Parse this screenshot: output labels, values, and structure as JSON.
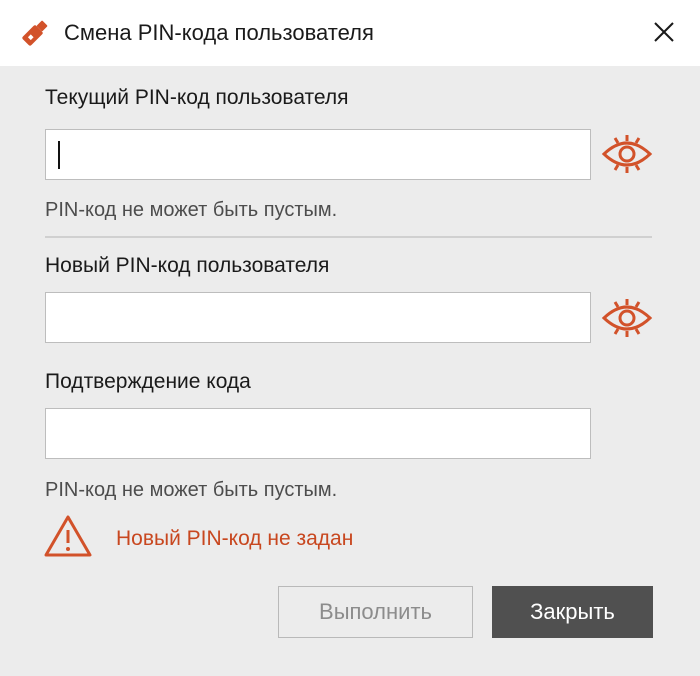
{
  "window": {
    "title": "Смена PIN-кода пользователя"
  },
  "current_pin": {
    "label": "Текущий PIN-код пользователя",
    "value": "",
    "hint": "PIN-код не может быть пустым."
  },
  "new_pin": {
    "label": "Новый PIN-код пользователя",
    "value": ""
  },
  "confirm_pin": {
    "label": "Подтверждение кода",
    "value": "",
    "hint": "PIN-код не может быть пустым."
  },
  "error": {
    "message": "Новый PIN-код не задан"
  },
  "buttons": {
    "run_label": "Выполнить",
    "close_label": "Закрыть"
  },
  "colors": {
    "accent": "#d2522a",
    "error_text": "#c8471f",
    "close_button_bg": "#505050"
  },
  "icons": {
    "app": "usb-token-icon",
    "close": "close-icon",
    "show_password": "eye-icon",
    "warning": "warning-icon"
  }
}
